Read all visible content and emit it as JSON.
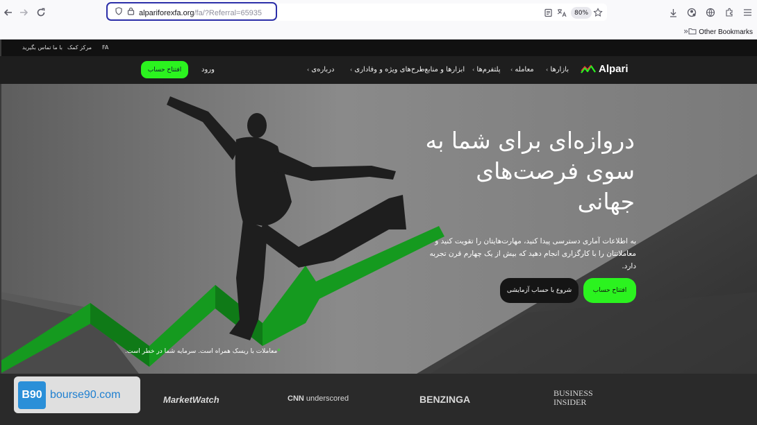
{
  "browser": {
    "url_host": "alpariforexfa.org",
    "url_path": "/fa/?Referral=65935",
    "zoom": "80%",
    "other_bookmarks": "Other Bookmarks"
  },
  "topstrip": {
    "contact": "با ما تماس بگیرید",
    "help_center": "مرکز کمک",
    "lang": "FA"
  },
  "nav": {
    "logo_text": "Alpari",
    "items": [
      "بازارها",
      "معامله",
      "پلتفرم‌ها",
      "ابزارها و منابع",
      "طرح‌های ویژه و وفاداری",
      "درباره‌ی"
    ],
    "login": "ورود",
    "open_account": "افتتاح حساب"
  },
  "hero": {
    "headline_1": "دروازه‌ای برای شما به",
    "headline_2": "سوی فرصت‌های",
    "headline_3": "جهانی",
    "sub_1": "به اطلاعات آماری دسترسی پیدا کنید، مهارت‌هایتان را تقویت کنید و",
    "sub_2": "معاملاتتان را با کارگزاری انجام دهید که بیش از یک چهارم قرن تجربه دارد.",
    "cta_primary": "افتتاح حساب",
    "cta_secondary": "شروع با حساب آزمایشی",
    "risk": "معاملات با ریسک همراه است. سرمایه شما در خطر است."
  },
  "press": {
    "marketwatch": "MarketWatch",
    "cnn": "CNN",
    "underscored": "underscored",
    "benzinga": "BENZINGA",
    "bi_1": "BUSINESS",
    "bi_2": "INSIDER"
  },
  "watermark": {
    "badge": "B90",
    "text": "bourse90.com"
  },
  "colors": {
    "accent_green": "#2bf31f",
    "chart_green": "#159a1f",
    "url_border": "#2b2ea8"
  }
}
